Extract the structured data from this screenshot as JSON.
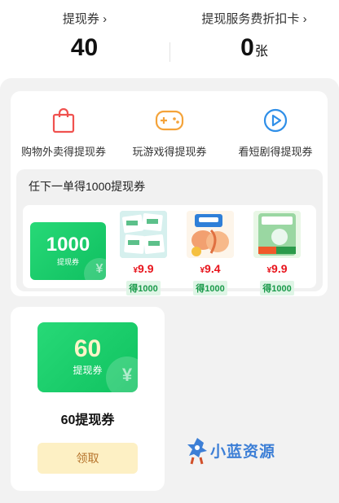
{
  "stats": [
    {
      "label": "提现券",
      "value": "40",
      "unit": ""
    },
    {
      "label": "提现服务费折扣卡",
      "value": "0",
      "unit": "张"
    }
  ],
  "categories": [
    {
      "label": "购物外卖得提现券",
      "icon": "shopping-bag-icon",
      "color": "#f0524f"
    },
    {
      "label": "玩游戏得提现券",
      "icon": "gamepad-icon",
      "color": "#f4a33a"
    },
    {
      "label": "看短剧得提现券",
      "icon": "play-icon",
      "color": "#2f8fe8"
    }
  ],
  "order_section": {
    "title": "任下一单得1000提现券",
    "coupon": {
      "value": "1000",
      "unit": "提现券",
      "watermark": "¥"
    },
    "products": [
      {
        "price_symbol": "¥",
        "price": "9.9",
        "earn": "得1000"
      },
      {
        "price_symbol": "¥",
        "price": "9.4",
        "earn": "得1000"
      },
      {
        "price_symbol": "¥",
        "price": "9.9",
        "earn": "得1000"
      }
    ]
  },
  "claim_card": {
    "coupon_value": "60",
    "coupon_unit": "提现券",
    "watermark": "¥",
    "title": "60提现券",
    "button": "领取"
  },
  "watermark": "小蓝资源"
}
